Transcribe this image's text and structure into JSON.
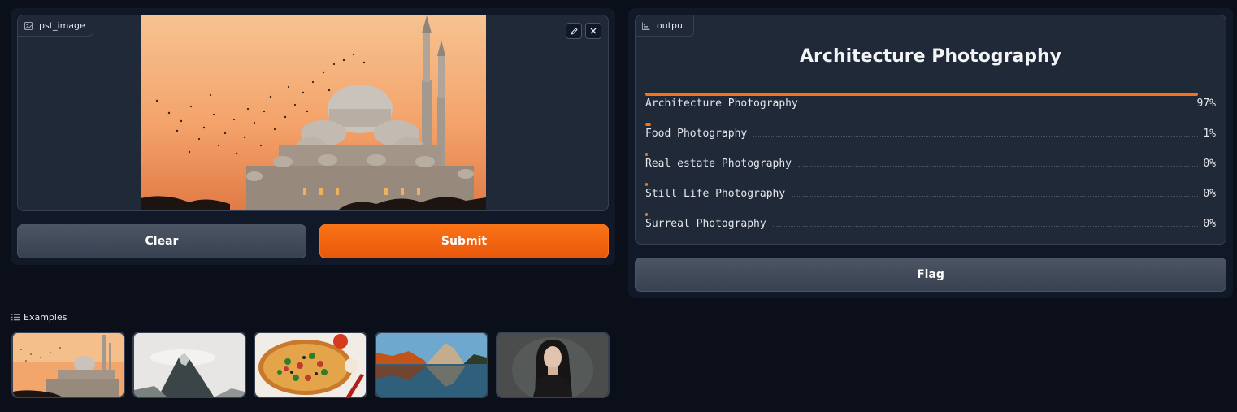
{
  "input": {
    "label": "pst_image"
  },
  "buttons": {
    "clear": "Clear",
    "submit": "Submit",
    "flag": "Flag"
  },
  "output": {
    "label": "output",
    "top_label": "Architecture Photography",
    "confidences": [
      {
        "label": "Architecture Photography",
        "percent": "97%",
        "value": 0.97
      },
      {
        "label": "Food Photography",
        "percent": "1%",
        "value": 0.01
      },
      {
        "label": "Real estate Photography",
        "percent": "0%",
        "value": 0.0
      },
      {
        "label": "Still Life Photography",
        "percent": "0%",
        "value": 0.0
      },
      {
        "label": "Surreal Photography",
        "percent": "0%",
        "value": 0.0
      }
    ]
  },
  "examples": {
    "header": "Examples",
    "items": [
      "mosque-sunset",
      "misty-mountain",
      "pizza",
      "mountain-lake",
      "woman-portrait"
    ]
  },
  "colors": {
    "accent": "#f97316",
    "background": "#0b0f19",
    "panel": "#111827",
    "block": "#1f2937"
  }
}
